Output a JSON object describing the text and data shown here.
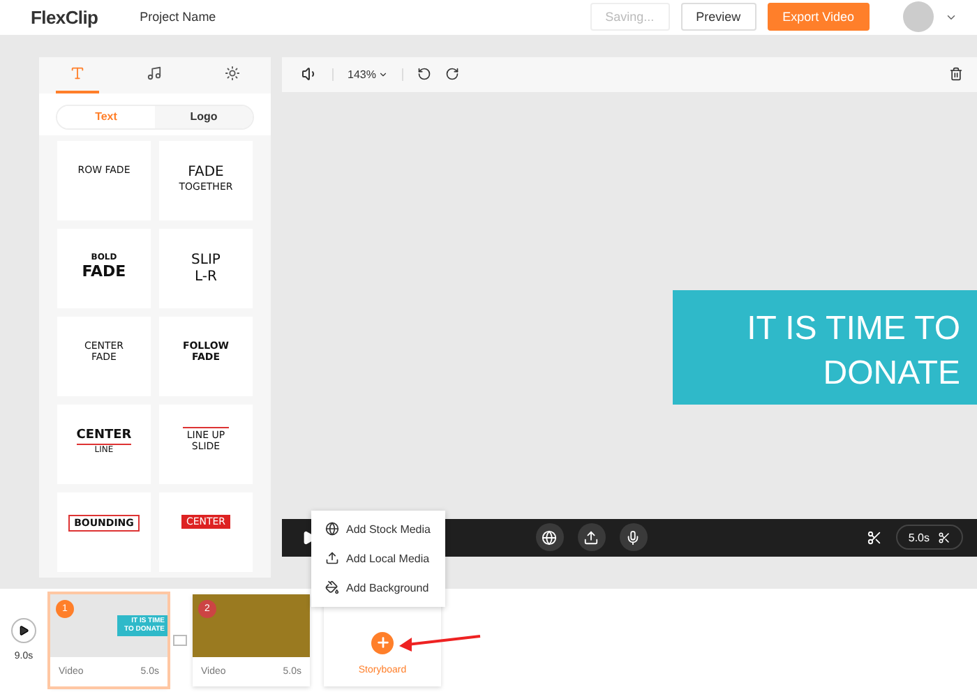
{
  "header": {
    "logo": "FlexClip",
    "project_name": "Project Name",
    "buttons": [
      {
        "label": "Saving...",
        "kind": "disabled"
      },
      {
        "label": "Preview",
        "kind": "outline"
      },
      {
        "label": "Export Video",
        "kind": "primary"
      }
    ]
  },
  "panel": {
    "icon_tabs": [
      {
        "selected": true
      },
      {
        "selected": false
      },
      {
        "selected": false
      }
    ],
    "segments": [
      {
        "label": "Text",
        "selected": true
      },
      {
        "label": "Logo",
        "selected": false
      }
    ],
    "templates": [
      {
        "kind": "plain",
        "lines": [
          {
            "text": "ROW FADE",
            "kind": "small"
          }
        ]
      },
      {
        "kind": "plain",
        "lines": [
          {
            "text": "FADE",
            "kind": "large"
          },
          {
            "text": "TOGETHER",
            "kind": "small"
          }
        ]
      },
      {
        "kind": "plain",
        "lines": [
          {
            "text": "BOLD",
            "kind": "tiny-bold"
          },
          {
            "text": "FADE",
            "kind": "large-bold"
          }
        ]
      },
      {
        "kind": "plain",
        "lines": [
          {
            "text": "SLIP",
            "kind": "large"
          },
          {
            "text": "L-R",
            "kind": "large"
          }
        ]
      },
      {
        "kind": "plain",
        "lines": [
          {
            "text": "CENTER",
            "kind": "small"
          },
          {
            "text": "FADE",
            "kind": "small"
          }
        ]
      },
      {
        "kind": "plain",
        "lines": [
          {
            "text": "FOLLOW",
            "kind": "small-bold"
          },
          {
            "text": "FADE",
            "kind": "small-bold"
          }
        ]
      },
      {
        "kind": "underline",
        "lines": [
          {
            "text": "CENTER",
            "kind": "medium-bold"
          },
          {
            "text": "LINE",
            "kind": "tiny"
          }
        ]
      },
      {
        "kind": "overline",
        "lines": [
          {
            "text": "LINE UP",
            "kind": "small"
          },
          {
            "text": "SLIDE",
            "kind": "small"
          }
        ]
      },
      {
        "kind": "boxed",
        "lines": [
          {
            "text": "BOUNDING",
            "kind": "small-bold"
          }
        ]
      },
      {
        "kind": "filled",
        "lines": [
          {
            "text": "CENTER",
            "kind": "small"
          }
        ]
      }
    ]
  },
  "toolbar": {
    "zoom": "143%"
  },
  "canvas": {
    "banner": "IT IS TIME TO DONATE"
  },
  "player": {
    "duration": "5.0s"
  },
  "menu": {
    "items": [
      {
        "label": "Add Stock Media"
      },
      {
        "label": "Add Local Media"
      },
      {
        "label": "Add Background"
      }
    ]
  },
  "timeline": {
    "total": "9.0s",
    "clips": [
      {
        "number": "1",
        "selected": true,
        "kind": "text",
        "thumb_text": "IT IS TIME TO DONATE",
        "type": "Video",
        "duration": "5.0s"
      },
      {
        "number": "2",
        "selected": false,
        "kind": "photo",
        "type": "Video",
        "duration": "5.0s"
      }
    ],
    "add_label": "Storyboard"
  }
}
